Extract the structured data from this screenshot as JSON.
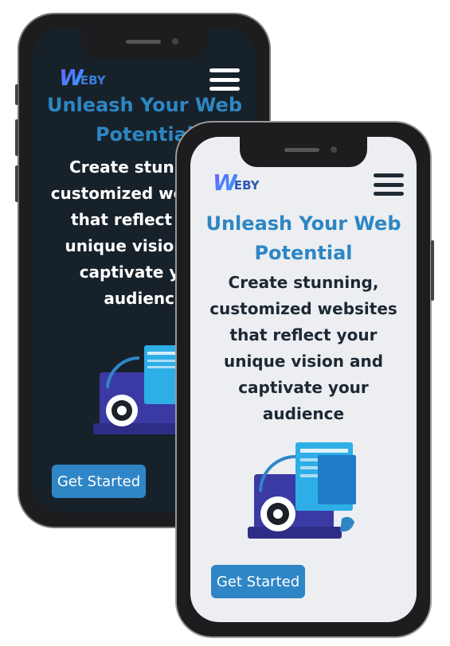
{
  "brand": {
    "logo_w": "W",
    "logo_rest": "EBY"
  },
  "hero": {
    "title": "Unleash Your Web Potential",
    "subtitle": "Create stunning, customized websites that reflect your unique vision and captivate your audience"
  },
  "cta": {
    "label": "Get Started"
  },
  "icons": {
    "menu": "hamburger-icon",
    "illustration": "web-development-illustration"
  },
  "colors": {
    "accent": "#2f86c6",
    "dark_bg": "#17212a",
    "light_bg": "#eceef1",
    "title": "#2d86c4"
  }
}
